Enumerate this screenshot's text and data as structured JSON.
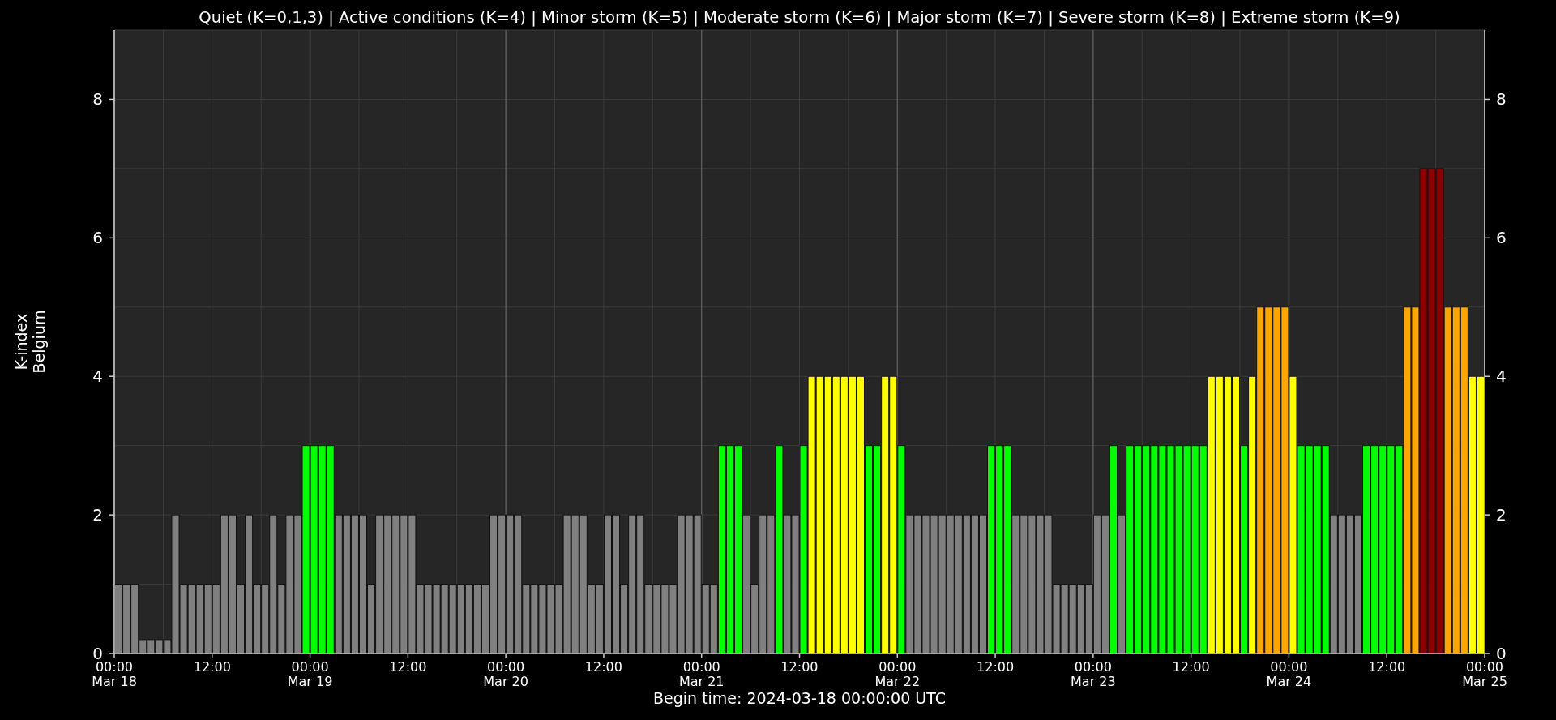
{
  "chart_data": {
    "type": "bar",
    "title": "Quiet (K=0,1,3) | Active conditions (K=4) | Minor storm (K=5) | Moderate storm (K=6) | Major storm (K=7) | Severe storm (K=8) | Extreme storm (K=9)",
    "xlabel": "Begin time: 2024-03-18 00:00:00 UTC",
    "ylabel": "K-index\nBelgium",
    "ylim": [
      0,
      9
    ],
    "yticks": [
      0,
      2,
      4,
      6,
      8
    ],
    "grid": true,
    "annotations": [
      "0",
      "2",
      "4",
      "6",
      "8"
    ],
    "categories": [
      "00:00\nMar 18",
      null,
      null,
      null,
      null,
      null,
      null,
      null,
      null,
      null,
      null,
      null,
      "12:00",
      null,
      null,
      null,
      null,
      null,
      null,
      null,
      null,
      null,
      null,
      null,
      "00:00\nMar 19",
      null,
      null,
      null,
      null,
      null,
      null,
      null,
      null,
      null,
      null,
      null,
      "12:00",
      null,
      null,
      null,
      null,
      null,
      null,
      null,
      null,
      null,
      null,
      null,
      "00:00\nMar 20",
      null,
      null,
      null,
      null,
      null,
      null,
      null,
      null,
      null,
      null,
      null,
      "12:00",
      null,
      null,
      null,
      null,
      null,
      null,
      null,
      null,
      null,
      null,
      null,
      "00:00\nMar 21",
      null,
      null,
      null,
      null,
      null,
      null,
      null,
      null,
      null,
      null,
      null,
      "12:00",
      null,
      null,
      null,
      null,
      null,
      null,
      null,
      null,
      null,
      null,
      null,
      "00:00\nMar 22",
      null,
      null,
      null,
      null,
      null,
      null,
      null,
      null,
      null,
      null,
      null,
      "12:00",
      null,
      null,
      null,
      null,
      null,
      null,
      null,
      null,
      null,
      null,
      null,
      "00:00\nMar 23",
      null,
      null,
      null,
      null,
      null,
      null,
      null,
      null,
      null,
      null,
      null,
      "12:00",
      null,
      null,
      null,
      null,
      null,
      null,
      null,
      null,
      null,
      null,
      null,
      "00:00\nMar 24",
      null,
      null,
      null,
      null,
      null,
      null,
      null,
      null,
      null,
      null,
      null,
      "12:00",
      null,
      null,
      null,
      null,
      null,
      null,
      null,
      null,
      null,
      null,
      null,
      "00:00\nMar 25"
    ],
    "series": [
      {
        "values": [
          1,
          1,
          1,
          0.2,
          0.2,
          0.2,
          0.2,
          2,
          1,
          1,
          1,
          1,
          1,
          2,
          2,
          1,
          2,
          1,
          1,
          2,
          1,
          2,
          2,
          3,
          3,
          3,
          3,
          2,
          2,
          2,
          2,
          1,
          2,
          2,
          2,
          2,
          2,
          1,
          1,
          1,
          1,
          1,
          1,
          1,
          1,
          1,
          2,
          2,
          2,
          2,
          1,
          1,
          1,
          1,
          1,
          2,
          2,
          2,
          1,
          1,
          2,
          2,
          1,
          2,
          2,
          1,
          1,
          1,
          1,
          2,
          2,
          2,
          1,
          1,
          3,
          3,
          3,
          2,
          1,
          2,
          2,
          3,
          2,
          2,
          3,
          4,
          4,
          4,
          4,
          4,
          4,
          4,
          3,
          3,
          4,
          4,
          3,
          2,
          2,
          2,
          2,
          2,
          2,
          2,
          2,
          2,
          2,
          3,
          3,
          3,
          2,
          2,
          2,
          2,
          2,
          1,
          1,
          1,
          1,
          1,
          2,
          2,
          3,
          2,
          3,
          3,
          3,
          3,
          3,
          3,
          3,
          3,
          3,
          3,
          4,
          4,
          4,
          4,
          3,
          4,
          5,
          5,
          5,
          5,
          4,
          3,
          3,
          3,
          3,
          2,
          2,
          2,
          2,
          3,
          3,
          3,
          3,
          3,
          5,
          5,
          7,
          7,
          7,
          5,
          5,
          5,
          4,
          4,
          null
        ]
      }
    ]
  }
}
